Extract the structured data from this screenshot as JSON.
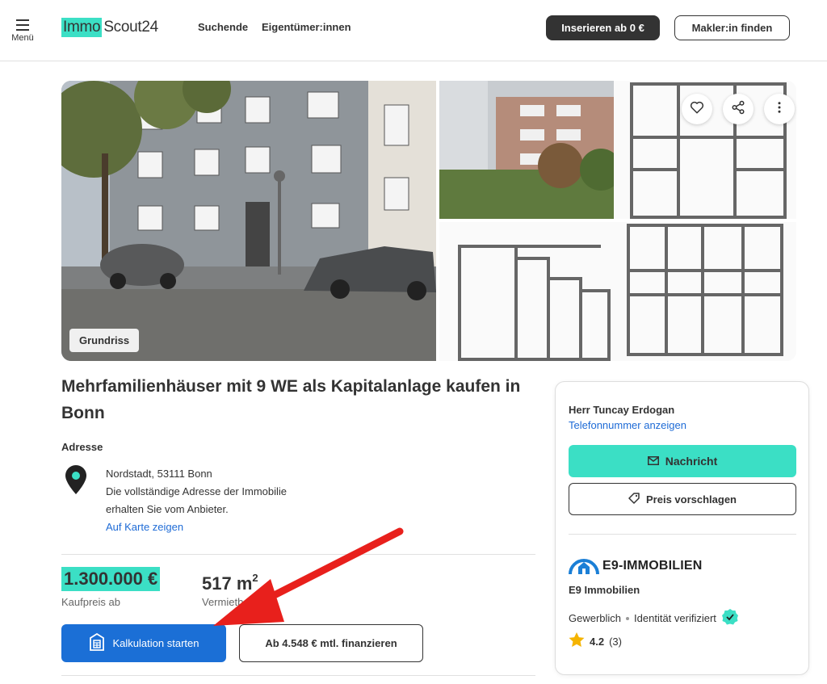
{
  "header": {
    "menu_label": "Menü",
    "logo_left": "Immo",
    "logo_right": "Scout24",
    "nav": [
      "Suchende",
      "Eigentümer:innen"
    ],
    "insert_button": "Inserieren ab 0 €",
    "agent_button": "Makler:in finden"
  },
  "gallery": {
    "tag": "Grundriss"
  },
  "listing": {
    "title": "Mehrfamilienhäuser mit 9 WE als Kapitalanlage kaufen in Bonn",
    "address_heading": "Adresse",
    "address_line1": "Nordstadt, 53111 Bonn",
    "address_line2": "Die vollständige Adresse der Immobilie",
    "address_line3": "erhalten Sie vom Anbieter.",
    "map_link": "Auf Karte zeigen",
    "price": "1.300.000 €",
    "price_label": "Kaufpreis ab",
    "area": "517 m",
    "area_sup": "2",
    "area_label": "Vermietbare Fl.",
    "calc_button": "Kalkulation starten",
    "finance_button": "Ab 4.548 € mtl. finanzieren"
  },
  "contact": {
    "agent_name": "Herr Tuncay Erdogan",
    "phone_link": "Telefonnummer anzeigen",
    "message_button": "Nachricht",
    "price_button": "Preis vorschlagen",
    "company_logo_text": "E9-IMMOBILIEN",
    "company_name": "E9 Immobilien",
    "type": "Gewerblich",
    "verified": "Identität verifiziert",
    "rating": "4.2",
    "rating_count": "(3)"
  },
  "colors": {
    "accent": "#3bdfc5",
    "primary_blue": "#1b6fd6",
    "arrow_red": "#e8201c"
  }
}
